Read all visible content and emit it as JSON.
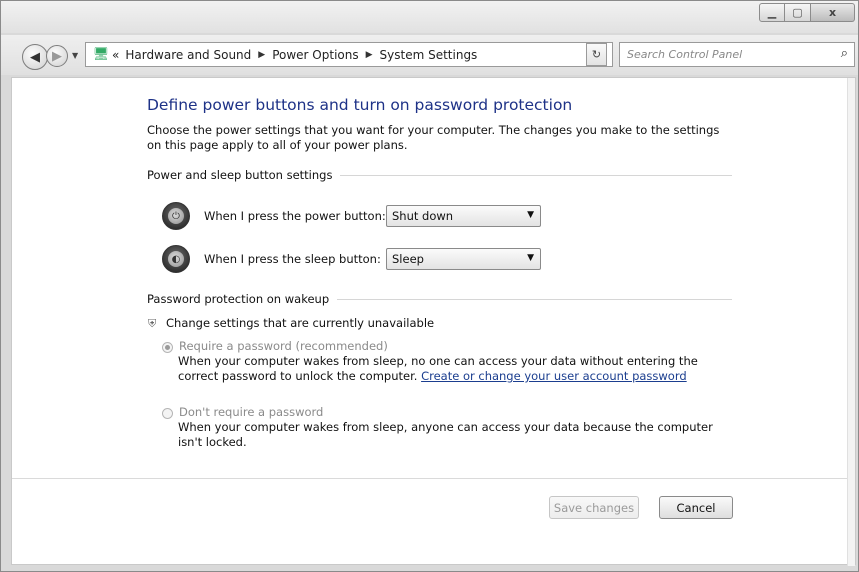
{
  "titlebar": {
    "min_label": "▁",
    "max_label": "▢",
    "close_label": "x"
  },
  "address": {
    "overflow": "«",
    "crumbs": [
      "Hardware and Sound",
      "Power Options",
      "System Settings"
    ]
  },
  "search": {
    "placeholder": "Search Control Panel"
  },
  "page": {
    "title": "Define power buttons and turn on password protection",
    "description": "Choose the power settings that you want for your computer. The changes you make to the settings on this page apply to all of your power plans."
  },
  "power_section": {
    "heading": "Power and sleep button settings",
    "power_label": "When I press the power button:",
    "power_value": "Shut down",
    "sleep_label": "When I press the sleep button:",
    "sleep_value": "Sleep"
  },
  "password_section": {
    "heading": "Password protection on wakeup",
    "change_settings": "Change settings that are currently unavailable",
    "require_label": "Require a password (recommended)",
    "require_desc_1": "When your computer wakes from sleep, no one can access your data without entering the correct password to unlock the computer.",
    "require_link": "Create or change your user account password",
    "norequire_label": "Don't require a password",
    "norequire_desc": "When your computer wakes from sleep, anyone can access your data because the computer isn't locked.",
    "selected": "require"
  },
  "buttons": {
    "save": "Save changes",
    "cancel": "Cancel"
  },
  "icons": {
    "back": "back-arrow-icon",
    "forward": "forward-arrow-icon",
    "control_panel": "control-panel-icon",
    "refresh": "refresh-icon",
    "search": "search-icon",
    "power": "power-button-icon",
    "sleep": "sleep-button-icon",
    "shield": "uac-shield-icon"
  },
  "colors": {
    "title": "#1e3287",
    "link": "#1b3e8f"
  }
}
